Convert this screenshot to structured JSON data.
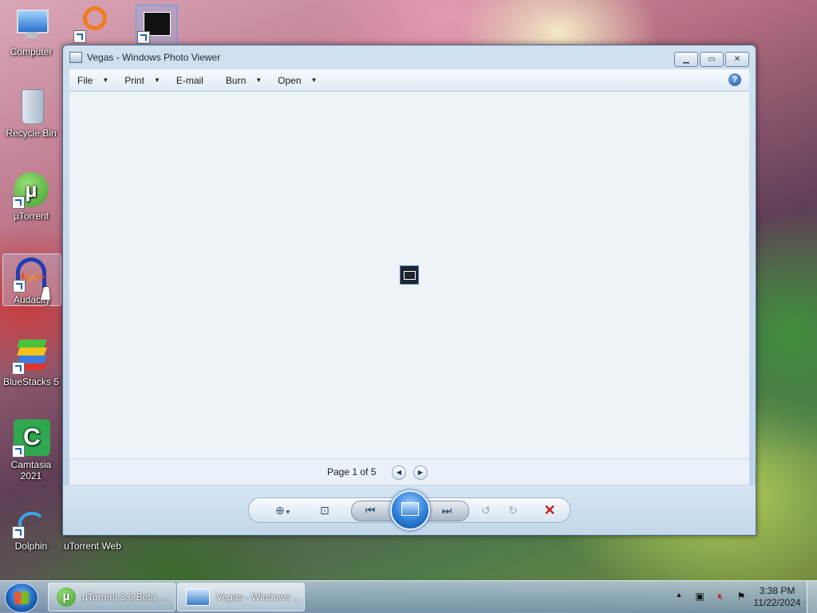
{
  "desktop": {
    "icons": [
      {
        "label": "Computer"
      },
      {
        "label": "Recycle Bin"
      },
      {
        "label": "µTorrent"
      },
      {
        "label": "Audacity"
      },
      {
        "label": "BlueStacks 5"
      },
      {
        "label": "Camtasia 2021"
      },
      {
        "label": "Dolphin"
      },
      {
        "label": "uTorrent Web"
      }
    ]
  },
  "window": {
    "title": "Vegas - Windows Photo Viewer",
    "menu": [
      {
        "label": "File"
      },
      {
        "label": "Print"
      },
      {
        "label": "E-mail"
      },
      {
        "label": "Burn"
      },
      {
        "label": "Open"
      }
    ],
    "help_icon": "?",
    "page_label": "Page 1 of 5"
  },
  "taskbar": {
    "tasks": [
      {
        "label": "µTorrent 3.6 Beta ..."
      },
      {
        "label": "Vegas - Windows ..."
      }
    ],
    "clock": {
      "time": "3:38 PM",
      "date": "11/22/2024"
    }
  }
}
